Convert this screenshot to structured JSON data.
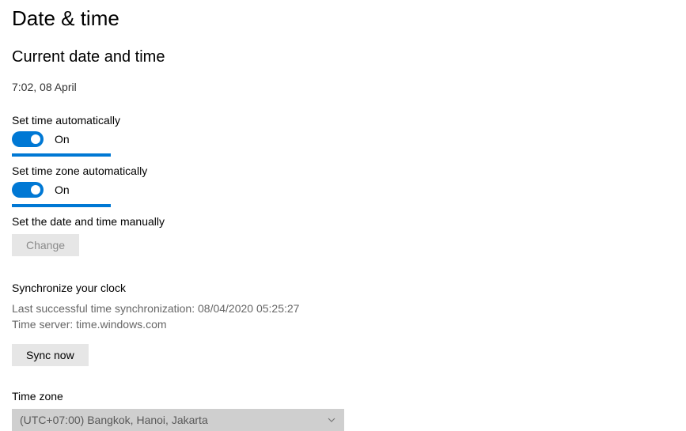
{
  "pageTitle": "Date & time",
  "current": {
    "heading": "Current date and time",
    "value": "7:02, 08 April"
  },
  "setTimeAuto": {
    "label": "Set time automatically",
    "state": "On"
  },
  "setZoneAuto": {
    "label": "Set time zone automatically",
    "state": "On"
  },
  "manual": {
    "label": "Set the date and time manually",
    "button": "Change"
  },
  "sync": {
    "heading": "Synchronize your clock",
    "lastSync": "Last successful time synchronization: 08/04/2020 05:25:27",
    "server": "Time server: time.windows.com",
    "button": "Sync now"
  },
  "timezone": {
    "label": "Time zone",
    "selected": "(UTC+07:00) Bangkok, Hanoi, Jakarta"
  }
}
